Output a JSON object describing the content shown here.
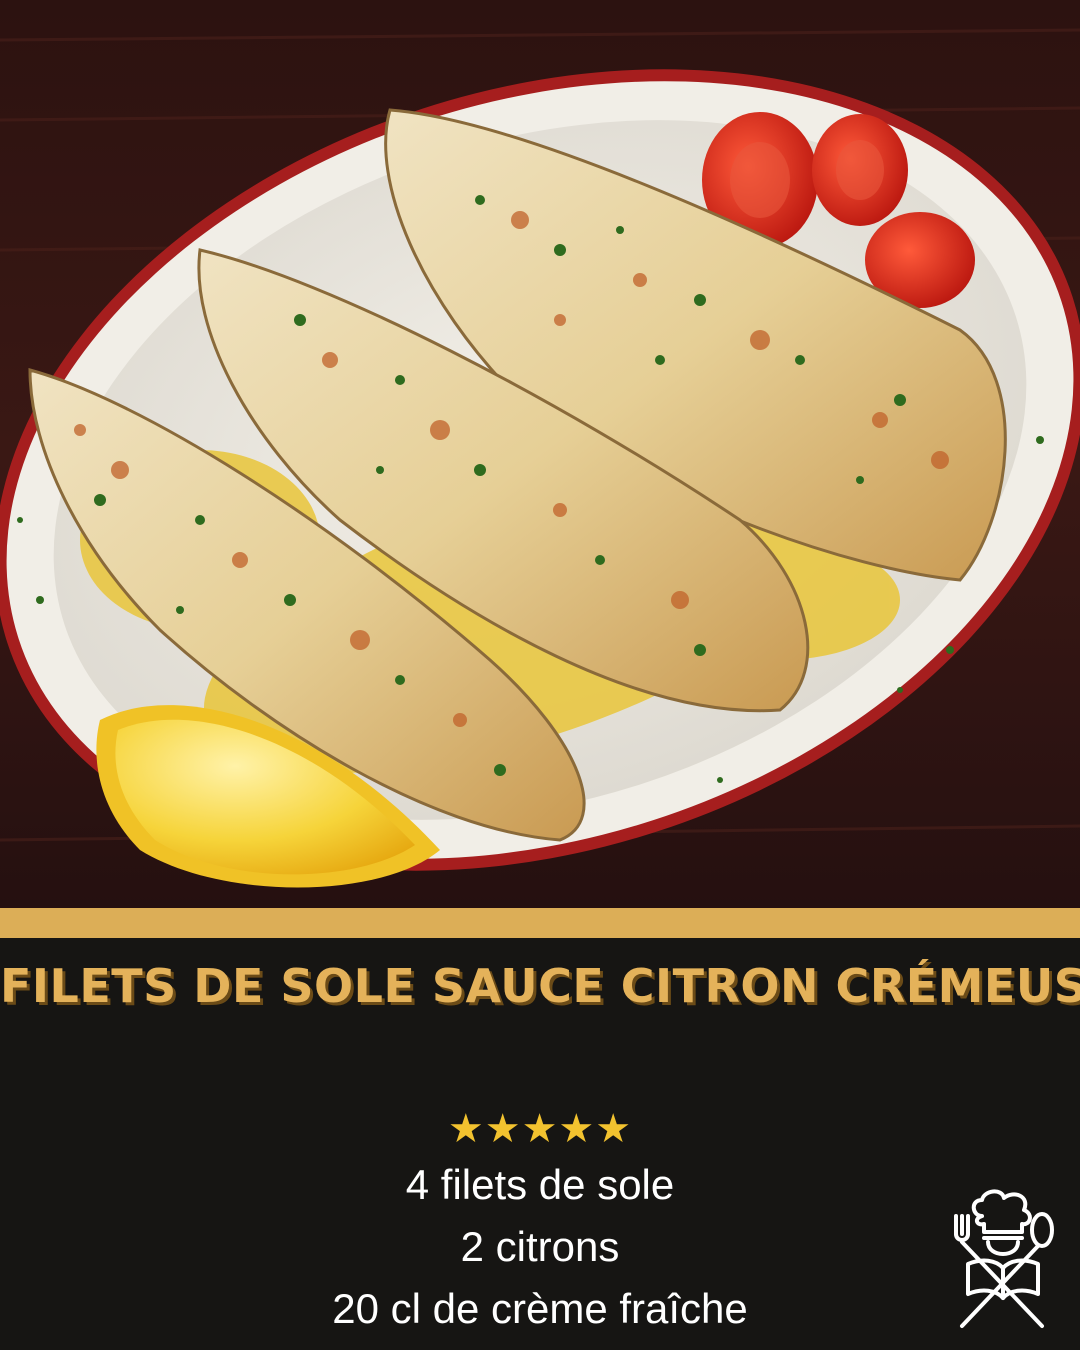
{
  "title": "Filets de sole sauce citron crémeuse",
  "rating": "★★★★★",
  "ingredients": [
    "4 filets de sole",
    "2 citrons",
    "20 cl de crème fraîche"
  ],
  "colors": {
    "background": "#161513",
    "accent_gold": "#dcae57",
    "title_text": "#e4b25a",
    "star": "#f2c22f",
    "ingredient_text": "#ffffff",
    "plate_rim": "#a61e1e"
  },
  "icons": {
    "logo": "chef-book-cutlery-icon"
  }
}
